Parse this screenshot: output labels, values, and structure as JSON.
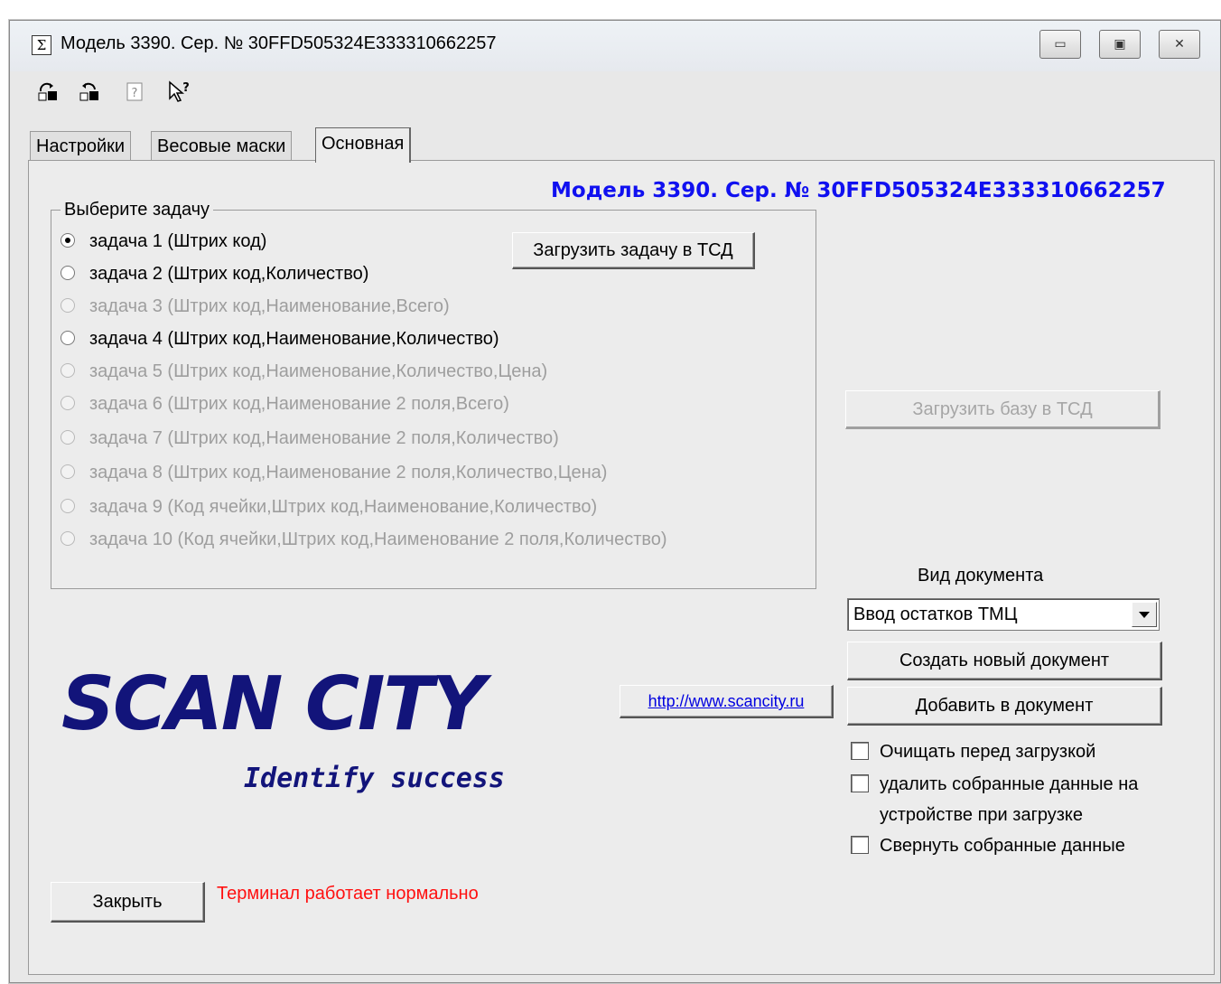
{
  "window": {
    "title": "Модель 3390. Сер. № 30FFD505324E333310662257",
    "controls": {
      "minimize": "▭",
      "maximize": "▣",
      "close": "✕"
    }
  },
  "toolbar": {
    "icons": [
      "device-upload-icon",
      "device-download-icon",
      "help-icon",
      "context-help-pointer-icon"
    ],
    "glyphs": {
      "upload": "⎌",
      "download": "⎌",
      "help": "?",
      "pointer": "↖?"
    }
  },
  "tabs": [
    {
      "label": "Настройки",
      "active": false
    },
    {
      "label": "Весовые маски",
      "active": false
    },
    {
      "label": "Основная",
      "active": true
    }
  ],
  "main": {
    "model_title": "Модель 3390. Сер. № 30FFD505324E333310662257",
    "task_group": {
      "legend": "Выберите задачу",
      "tasks": [
        {
          "label": "задача 1 (Штрих код)",
          "checked": true,
          "enabled": true
        },
        {
          "label": "задача 2 (Штрих код,Количество)",
          "checked": false,
          "enabled": true
        },
        {
          "label": "задача 3 (Штрих код,Наименование,Всего)",
          "checked": false,
          "enabled": false
        },
        {
          "label": "задача 4 (Штрих код,Наименование,Количество)",
          "checked": false,
          "enabled": true
        },
        {
          "label": "задача 5 (Штрих код,Наименование,Количество,Цена)",
          "checked": false,
          "enabled": false
        },
        {
          "label": "задача 6 (Штрих код,Наименование 2 поля,Всего)",
          "checked": false,
          "enabled": false
        },
        {
          "label": "задача 7 (Штрих код,Наименование 2 поля,Количество)",
          "checked": false,
          "enabled": false
        },
        {
          "label": "задача 8 (Штрих код,Наименование 2 поля,Количество,Цена)",
          "checked": false,
          "enabled": false
        },
        {
          "label": "задача 9 (Код ячейки,Штрих код,Наименование,Количество)",
          "checked": false,
          "enabled": false
        },
        {
          "label": "задача 10 (Код ячейки,Штрих код,Наименование 2 поля,Количество)",
          "checked": false,
          "enabled": false
        }
      ],
      "load_task_button": "Загрузить задачу в ТСД"
    },
    "load_base_button": "Загрузить базу в ТСД",
    "document": {
      "label": "Вид документа",
      "selected": "Ввод остатков ТМЦ",
      "create_button": "Создать новый документ",
      "add_button": "Добавить в документ"
    },
    "options": [
      {
        "label": "Очищать перед загрузкой",
        "checked": false
      },
      {
        "label_line1": "удалить собранные данные на",
        "label_line2": "устройстве при загрузке",
        "checked": false
      },
      {
        "label": "Свернуть собранные данные",
        "checked": false
      }
    ],
    "website_link": "http://www.scancity.ru",
    "logo_text": "SCAN CITY",
    "slogan": "Identify success",
    "close_button": "Закрыть",
    "status_text": "Терминал работает нормально"
  },
  "colors": {
    "model_title": "#1010f0",
    "logo": "#12147a",
    "status": "#ff1010",
    "link": "#0000e0"
  }
}
